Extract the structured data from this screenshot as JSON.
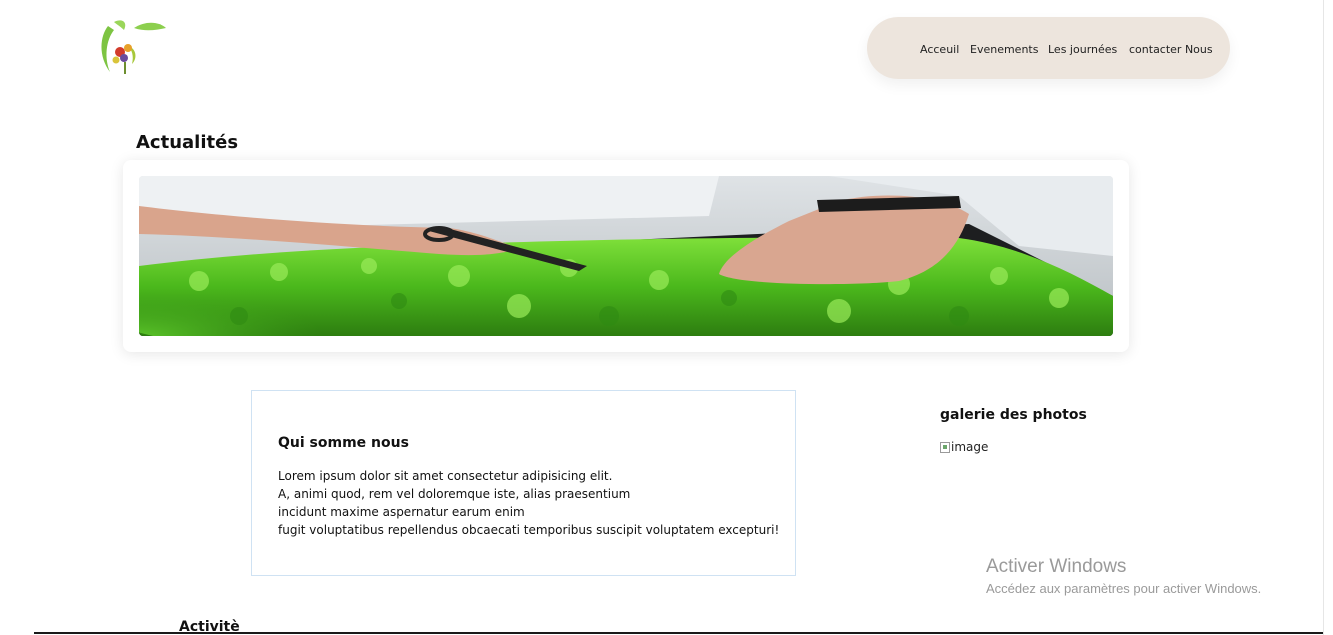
{
  "brand": {
    "logo_icon": "tree-fruit-logo-icon"
  },
  "nav": {
    "items": [
      {
        "label": "Acceuil"
      },
      {
        "label": "Evenements"
      },
      {
        "label": "Les journées"
      },
      {
        "label": "contacter Nous"
      }
    ]
  },
  "news": {
    "title": "Actualités",
    "banner_icon": "green-plants-harvest-photo"
  },
  "about": {
    "title": "Qui somme nous",
    "lines": [
      "Lorem ipsum dolor sit amet consectetur adipisicing elit.",
      "A, animi quod, rem vel doloremque iste, alias praesentium",
      "incidunt maxime aspernatur earum enim",
      "fugit voluptatibus repellendus obcaecati temporibus suscipit voluptatem excepturi!"
    ]
  },
  "gallery": {
    "title": "galerie des photos",
    "image_alt": "image"
  },
  "activities": {
    "title": "Activitè"
  },
  "windows_notice": {
    "title": "Activer Windows",
    "subtitle": "Accédez aux paramètres pour activer Windows."
  },
  "colors": {
    "nav_bg": "#ede5dd",
    "card_border": "#cfe2f3",
    "plant_green": "#4fb51f"
  }
}
